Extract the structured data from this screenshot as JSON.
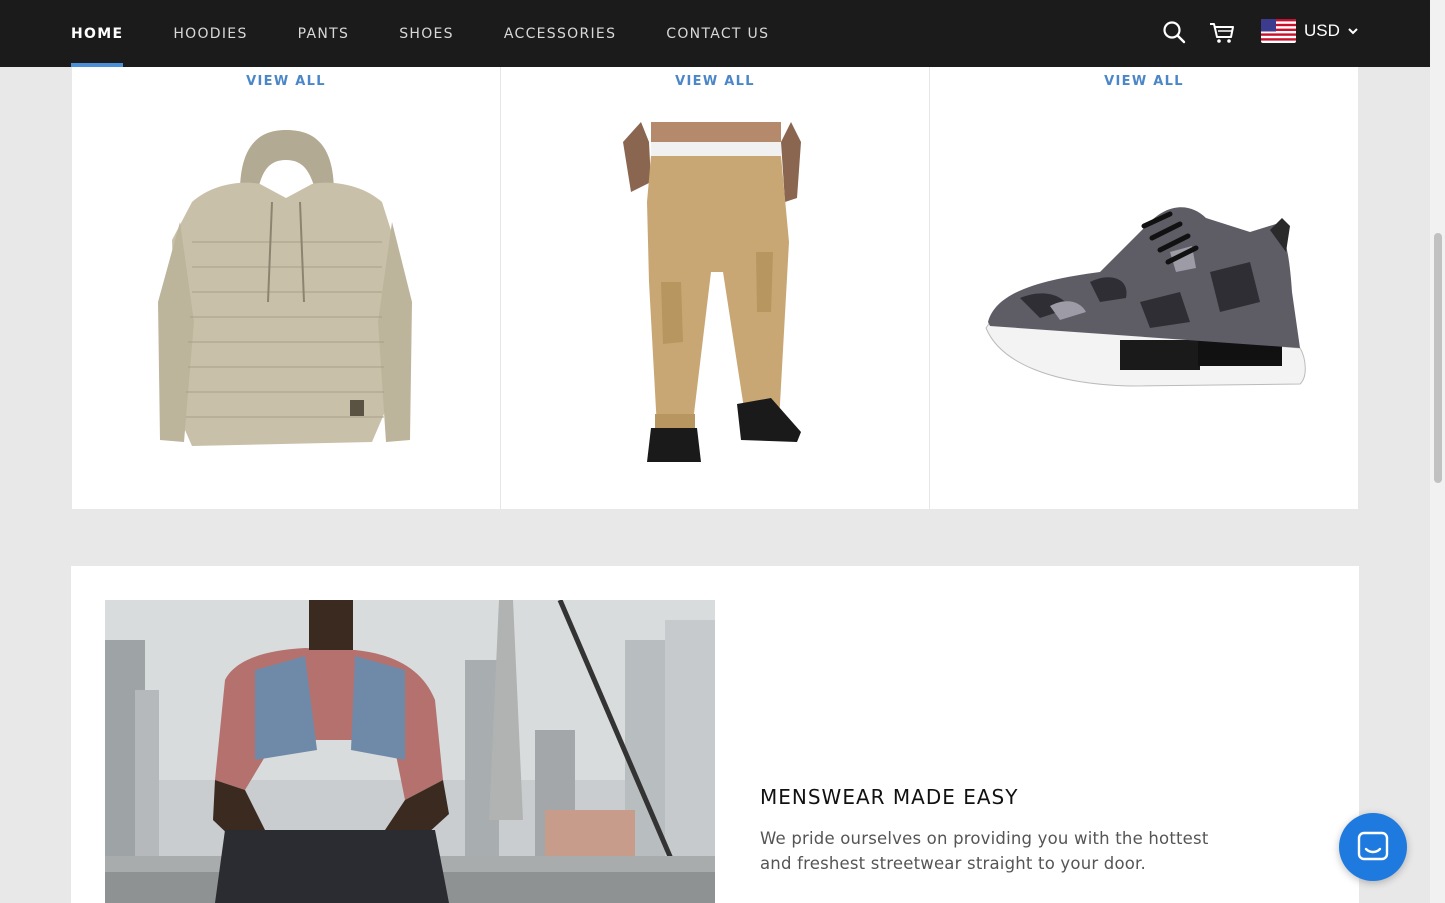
{
  "header": {
    "nav": [
      {
        "label": "HOME",
        "active": true
      },
      {
        "label": "HOODIES",
        "active": false
      },
      {
        "label": "PANTS",
        "active": false
      },
      {
        "label": "SHOES",
        "active": false
      },
      {
        "label": "ACCESSORIES",
        "active": false
      },
      {
        "label": "CONTACT US",
        "active": false
      }
    ],
    "icons": {
      "search": "search-icon",
      "cart": "cart-icon"
    },
    "currency": {
      "label": "USD",
      "flag": "us-flag-icon"
    }
  },
  "collections": [
    {
      "link": "VIEW ALL",
      "image": "beige knit hoodie"
    },
    {
      "link": "VIEW ALL",
      "image": "khaki cargo jogger pants"
    },
    {
      "link": "VIEW ALL",
      "image": "camo sneaker"
    }
  ],
  "feature": {
    "title": "MENSWEAR MADE EASY",
    "text": "We pride ourselves on providing you with the hottest and freshest streetwear straight to your door."
  },
  "colors": {
    "header_bg": "#1b1b1b",
    "accent": "#4a90d9",
    "link": "#4a86c8",
    "chat": "#1f7ae0"
  }
}
